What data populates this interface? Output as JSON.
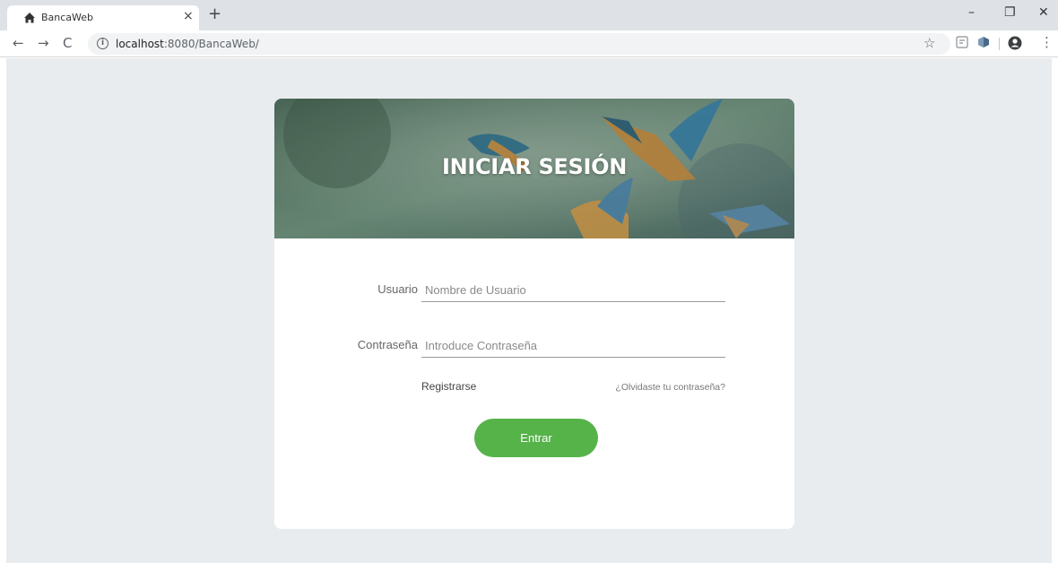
{
  "browser": {
    "tab_title": "BancaWeb",
    "tab_icon": "home-icon",
    "tab_close": "×",
    "new_tab": "+",
    "url_host": "localhost",
    "url_rest": ":8080/BancaWeb/",
    "window_controls": {
      "minimize": "–",
      "restore": "❐",
      "close": "✕"
    }
  },
  "login": {
    "title": "INICIAR SESIÓN",
    "username_label": "Usuario",
    "username_placeholder": "Nombre de Usuario",
    "password_label": "Contraseña",
    "password_placeholder": "Introduce Contraseña",
    "register_link": "Registrarse",
    "forgot_link": "¿Olvidaste tu contraseña?",
    "submit_label": "Entrar"
  },
  "colors": {
    "page_background": "#e9ecee",
    "card_background": "#ffffff",
    "submit_button": "#56b34a"
  }
}
